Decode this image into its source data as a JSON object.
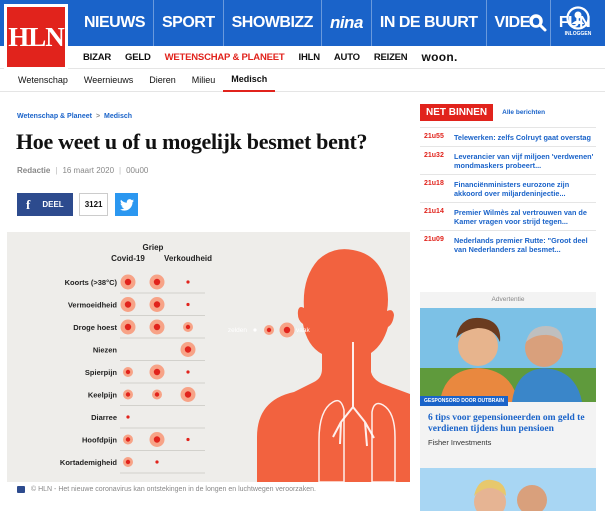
{
  "brand": {
    "logo_text": "HLN",
    "blue": "#1a63c9",
    "red": "#e1231c"
  },
  "main_nav": [
    "NIEUWS",
    "SPORT",
    "SHOWBIZZ",
    "nina",
    "IN DE BUURT",
    "VIDEO",
    "FUN"
  ],
  "header_icons": {
    "search": "search-icon",
    "profile": "user-icon",
    "profile_label": "INLOGGEN"
  },
  "secondary_nav": [
    "BIZAR",
    "GELD",
    "WETENSCHAP & PLANEET",
    "IHLN",
    "AUTO",
    "REIZEN",
    "woon."
  ],
  "secondary_active": "WETENSCHAP & PLANEET",
  "sub_nav": [
    "Wetenschap",
    "Weernieuws",
    "Dieren",
    "Milieu",
    "Medisch"
  ],
  "sub_active": "Medisch",
  "breadcrumb": {
    "section": "Wetenschap & Planeet",
    "sep": ">",
    "page": "Medisch"
  },
  "article": {
    "title": "Hoe weet u of u mogelijk besmet bent?",
    "author": "Redactie",
    "date": "16 maart 2020",
    "time": "00u00",
    "share_label": "DEEL",
    "share_count": "3121",
    "caption": "© HLN - Het nieuwe coronavirus kan ontstekingen in de longen en luchtwegen veroorzaken."
  },
  "infographic": {
    "col_griep": "Griep",
    "col_covid": "Covid-19",
    "col_cold": "Verkoudheid",
    "legend_rare": "zelden",
    "legend_often": "vaak",
    "symptoms": [
      {
        "name": "Koorts (>38°C)",
        "covid": 2,
        "griep": 2,
        "cold": 0
      },
      {
        "name": "Vermoeidheid",
        "covid": 2,
        "griep": 2,
        "cold": 0
      },
      {
        "name": "Droge hoest",
        "covid": 2,
        "griep": 2,
        "cold": 1
      },
      {
        "name": "Niezen",
        "covid": -1,
        "griep": -1,
        "cold": 2
      },
      {
        "name": "Spierpijn",
        "covid": 1,
        "griep": 2,
        "cold": 0
      },
      {
        "name": "Keelpijn",
        "covid": 1,
        "griep": 1,
        "cold": 2
      },
      {
        "name": "Diarree",
        "covid": 0,
        "griep": -1,
        "cold": -1
      },
      {
        "name": "Hoofdpijn",
        "covid": 1,
        "griep": 2,
        "cold": 0
      },
      {
        "name": "Kortademigheid",
        "covid": 1,
        "griep": 0,
        "cold": -1
      }
    ]
  },
  "net_binnen": {
    "label": "NET BINNEN",
    "all_link": "Alle berichten",
    "items": [
      {
        "time": "21u55",
        "text": "Telewerken: zelfs Colruyt gaat overstag"
      },
      {
        "time": "21u32",
        "text": "Leverancier van vijf miljoen 'verdwenen' mondmaskers probeert..."
      },
      {
        "time": "21u18",
        "text": "Financiënministers eurozone zijn akkoord over miljardeninjectie..."
      },
      {
        "time": "21u14",
        "text": "Premier Wilmès zal vertrouwen van de Kamer vragen voor strijd tegen..."
      },
      {
        "time": "21u09",
        "text": "Nederlands premier Rutte: \"Groot deel van Nederlanders zal besmet..."
      }
    ]
  },
  "ad": {
    "label": "Advertentie",
    "sponsor": "GESPONSORD DOOR OUTBRAIN",
    "title": "6 tips voor gepensioneerden om geld te verdienen tijdens hun pensioen",
    "source": "Fisher Investments"
  }
}
